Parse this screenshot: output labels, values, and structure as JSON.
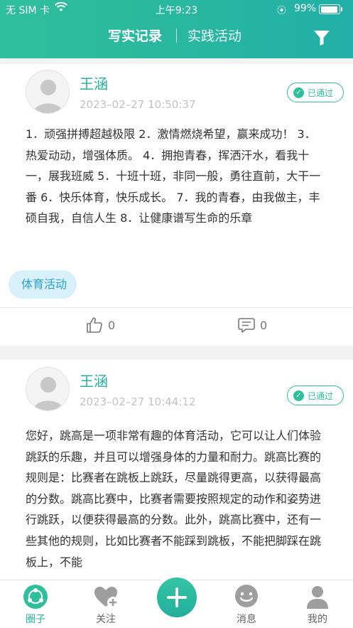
{
  "status_bar": {
    "carrier": "无 SIM 卡",
    "time": "上午9:23",
    "battery": "99%",
    "battery_level": 0.99
  },
  "header": {
    "tabs": [
      {
        "label": "写实记录"
      },
      {
        "label": "实践活动"
      }
    ],
    "filter_icon": "filter-icon"
  },
  "posts": [
    {
      "name": "王涵",
      "time": "2023–02–27 10:50:37",
      "badge": "已通过",
      "content": "1．顽强拼搏超越极限 2．激情燃烧希望，赢来成功！ 3．热爱动动，增强体质。 4．拥抱青春，挥洒汗水，看我十一，展我班威 5．十班十班，非同一般，勇往直前，大干一番 6．快乐体育，快乐成长。 7．我的青春，由我做主，丰硕自我，自信人生 8．让健康谱写生命的乐章",
      "tag": "体育活动",
      "likes": "0",
      "comments": "0"
    },
    {
      "name": "王涵",
      "time": "2023–02–27 10:44:12",
      "badge": "已通过",
      "content": "您好，跳高是一项非常有趣的体育活动，它可以让人们体验跳跃的乐趣，并且可以增强身体的力量和耐力。跳高比赛的规则是：比赛者在跳板上跳跃，尽量跳得更高，以获得最高的分数。跳高比赛中，比赛者需要按照规定的动作和姿势进行跳跃，以便获得最高的分数。此外，跳高比赛中，还有一些其他的规则，比如比赛者不能踩到跳板，不能把脚踩在跳板上，不能"
    }
  ],
  "tabbar": {
    "items": [
      {
        "label": "圈子",
        "icon": "circle-icon"
      },
      {
        "label": "关注",
        "icon": "heart-plus-icon"
      },
      {
        "label": "消息",
        "icon": "chat-icon"
      },
      {
        "label": "我的",
        "icon": "person-icon"
      }
    ],
    "add_icon": "plus-icon"
  },
  "colors": {
    "accent": "#26b39f",
    "tag_bg": "#d8f0fa",
    "tag_text": "#2aa3d9"
  }
}
